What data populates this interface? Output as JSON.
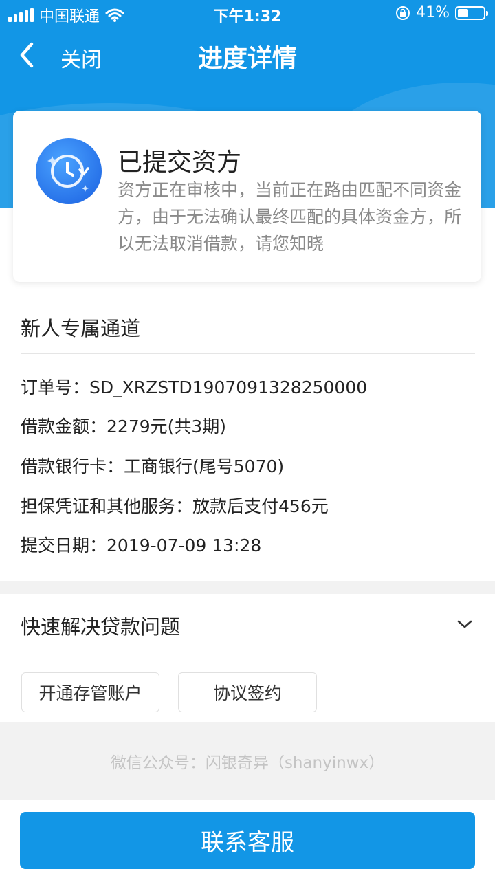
{
  "status_bar": {
    "carrier": "中国联通",
    "time": "下午1:32",
    "battery": "41%",
    "battery_level": 0.41,
    "icons": [
      "signal-icon",
      "wifi-icon",
      "rotation-lock-icon",
      "battery-icon"
    ]
  },
  "nav": {
    "back_icon": "chevron-left-icon",
    "close_label": "关闭",
    "title": "进度详情"
  },
  "status_card": {
    "icon": "clock-refresh-icon",
    "title": "已提交资方",
    "description": "资方正在审核中，当前正在路由匹配不同资金方，由于无法确认最终匹配的具体资金方，所以无法取消借款，请您知晓"
  },
  "order": {
    "section_title": "新人专属通道",
    "rows": [
      {
        "label": "订单号：",
        "value": "SD_XRZSTD1907091328250000"
      },
      {
        "label": "借款金额：",
        "value": "2279元(共3期)"
      },
      {
        "label": "借款银行卡：",
        "value": "工商银行(尾号5070)"
      },
      {
        "label": "担保凭证和其他服务：",
        "value": "放款后支付456元"
      },
      {
        "label": "提交日期：",
        "value": "2019-07-09 13:28"
      }
    ]
  },
  "quick_help": {
    "title": "快速解决贷款问题",
    "toggle_icon": "chevron-down-icon",
    "buttons": [
      "开通存管账户",
      "协议签约"
    ]
  },
  "footer": {
    "wechat_text": "微信公众号：闪银奇异（shanyinwx）"
  },
  "cta": {
    "label": "联系客服"
  },
  "colors": {
    "primary": "#1296e6",
    "background_gray": "#f2f2f2",
    "muted_text": "#8a8a8a"
  }
}
